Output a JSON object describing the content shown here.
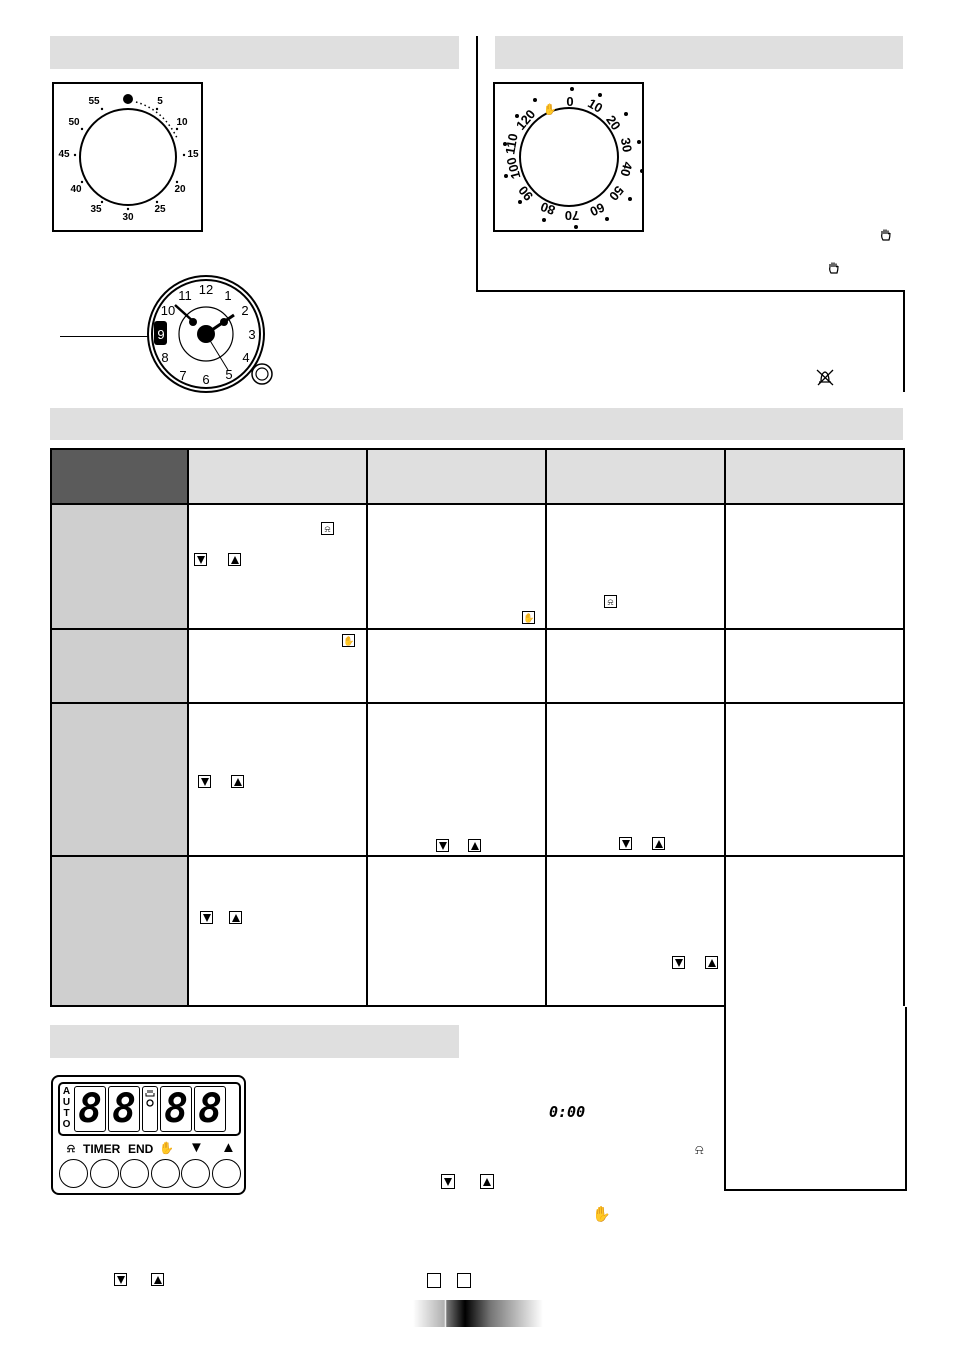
{
  "sections": {
    "minute_minder_header": "",
    "timer_dial_header": "",
    "programmer_table_header": "",
    "electronic_programmer_header": ""
  },
  "minute_minder_dial": {
    "labels": [
      "55",
      "5",
      "10",
      "15",
      "20",
      "25",
      "30",
      "35",
      "40",
      "45",
      "50"
    ]
  },
  "cooking_timer_dial": {
    "labels": [
      "0",
      "10",
      "20",
      "30",
      "40",
      "50",
      "60",
      "70",
      "80",
      "90",
      "100",
      "110",
      "120"
    ],
    "manual_symbol": "hand-icon"
  },
  "analog_clock": {
    "numerals": [
      "12",
      "1",
      "2",
      "3",
      "4",
      "5",
      "6",
      "7",
      "8",
      "9",
      "10",
      "11"
    ],
    "highlighted_numeral": "9"
  },
  "display_panel": {
    "auto_letters": [
      "A",
      "U",
      "T",
      "O"
    ],
    "digits": [
      "8",
      "8",
      "8",
      "8"
    ],
    "button_labels": {
      "timer": "TIMER",
      "end": "END"
    },
    "buttons": [
      "bell",
      "timer",
      "end",
      "manual",
      "down",
      "up"
    ]
  },
  "inline_readout": "0:00",
  "table": {
    "columns": [
      "",
      "",
      "",
      "",
      ""
    ],
    "rows": [
      {
        "label": ""
      },
      {
        "label": ""
      },
      {
        "label": ""
      },
      {
        "label": ""
      }
    ]
  },
  "icons": {
    "bell": "bell-icon",
    "hand": "hand-icon",
    "down": "down-arrow-key",
    "up": "up-arrow-key",
    "no_bell": "bell-crossed-icon"
  },
  "colors": {
    "section_bar": "#dfdfdf",
    "table_header_dark": "#5b5b5b",
    "table_row_header": "#cfcfcf"
  }
}
